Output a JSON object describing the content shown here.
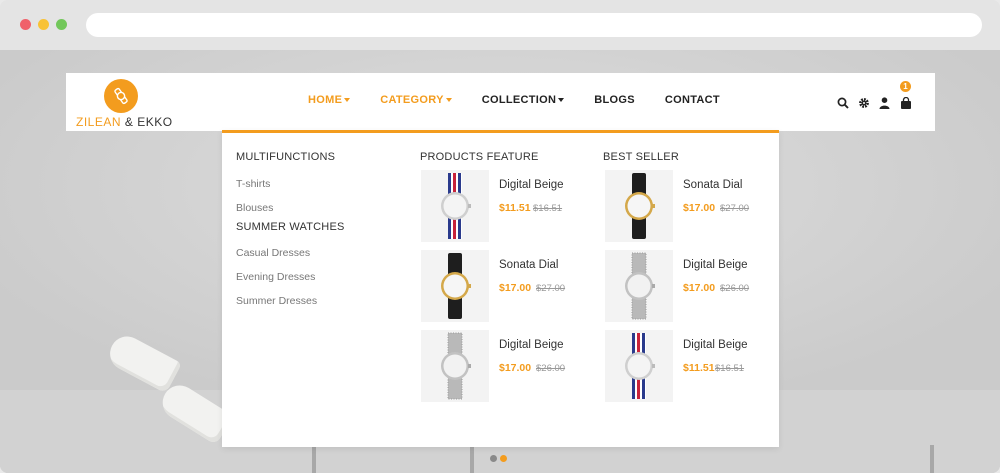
{
  "brand": {
    "name_part1": "ZILEAN",
    "name_sep": " & ",
    "name_part2": "EKKO",
    "accent_color": "#f39c1e"
  },
  "nav": {
    "home": "HOME",
    "category": "CATEGORY",
    "collection": "COLLECTION",
    "blogs": "BLOGS",
    "contact": "CONTACT"
  },
  "cart": {
    "count": "1"
  },
  "menu": {
    "multifunctions": {
      "title": "MULTIFUNCTIONS",
      "links": [
        "T-shirts",
        "Blouses"
      ]
    },
    "summer_watches": {
      "title": "SUMMER WATCHES",
      "links": [
        "Casual Dresses",
        "Evening Dresses",
        "Summer Dresses"
      ]
    },
    "products_feature": {
      "title": "PRODUCTS FEATURE",
      "items": [
        {
          "name": "Digital Beige",
          "price": "$11.51",
          "old_price": "$16.51"
        },
        {
          "name": "Sonata Dial",
          "price": "$17.00",
          "old_price": "$27.00"
        },
        {
          "name": "Digital Beige",
          "price": "$17.00",
          "old_price": "$26.00"
        }
      ]
    },
    "best_seller": {
      "title": "BEST SELLER",
      "items": [
        {
          "name": "Sonata Dial",
          "price": "$17.00",
          "old_price": "$27.00"
        },
        {
          "name": "Digital Beige",
          "price": "$17.00",
          "old_price": "$26.00"
        },
        {
          "name": "Digital Beige",
          "price": "$11.51",
          "old_price": "$16.51"
        }
      ]
    }
  }
}
